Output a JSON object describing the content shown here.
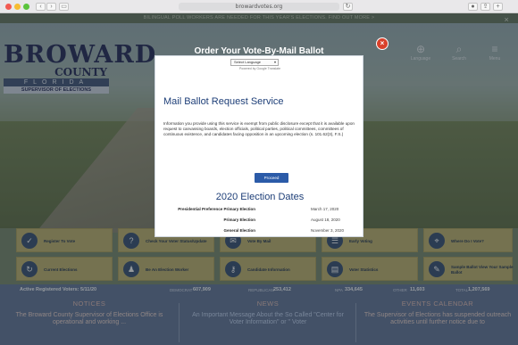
{
  "browser": {
    "url": "browardvotes.org",
    "nav_back": "‹",
    "nav_forward": "›",
    "sidebar_icon": "sidebar-icon",
    "reload": "↻"
  },
  "announcement": {
    "text": "BILINGUAL POLL WORKERS ARE NEEDED FOR THIS YEAR'S ELECTIONS. FIND OUT MORE >",
    "close": "×"
  },
  "logo": {
    "line1": "BROWARD",
    "line2": "COUNTY",
    "line3": "FLORIDA",
    "line4": "SUPERVISOR OF ELECTIONS"
  },
  "topnav": [
    {
      "label": "Language",
      "icon": "globe-icon",
      "glyph": "⊕"
    },
    {
      "label": "Search",
      "icon": "search-icon",
      "glyph": "⌕"
    },
    {
      "label": "Menu",
      "icon": "menu-icon",
      "glyph": "≡"
    }
  ],
  "modal": {
    "title": "Order Your Vote-By-Mail Ballot",
    "close": "×",
    "language_select": "Select Language",
    "powered_by": "Powered by Google Translate",
    "heading": "Mail Ballot Request Service",
    "body": "Information you provide using this service is exempt from public disclosure except that it is available upon request to canvassing boards, election officials, political parties, political committees, committees of continuous existence, and candidates facing opposition in an upcoming election (s. 101.62(3), F.S.)",
    "proceed": "Proceed",
    "dates_heading": "2020 Election Dates",
    "dates": [
      {
        "name": "Presidential Preference Primary Election",
        "date": "March 17, 2020"
      },
      {
        "name": "Primary Election",
        "date": "August 18, 2020"
      },
      {
        "name": "General Election",
        "date": "November 3, 2020"
      }
    ]
  },
  "tiles_row1": [
    {
      "label": "Register To Vote",
      "icon": "check-icon",
      "glyph": "✓"
    },
    {
      "label": "Check Your Voter Status/Update",
      "icon": "question-icon",
      "glyph": "?"
    },
    {
      "label": "Vote By Mail",
      "icon": "mail-icon",
      "glyph": "✉"
    },
    {
      "label": "Early Voting",
      "icon": "list-icon",
      "glyph": "☰"
    },
    {
      "label": "Where Do I Vote?",
      "icon": "location-icon",
      "glyph": "⌖"
    }
  ],
  "tiles_row2": [
    {
      "label": "Current Elections",
      "icon": "refresh-icon",
      "glyph": "↻"
    },
    {
      "label": "Be An Election Worker",
      "icon": "people-icon",
      "glyph": "♟"
    },
    {
      "label": "Candidate Information",
      "icon": "lock-icon",
      "glyph": "⚷"
    },
    {
      "label": "Voter Statistics",
      "icon": "stats-icon",
      "glyph": "▤"
    },
    {
      "label": "Sample Ballot View Your Sample Ballot",
      "icon": "ballot-icon",
      "glyph": "✎"
    }
  ],
  "stats": {
    "active_label": "Active Registered Voters: 5/11/20",
    "democrat_label": "DEMOCRAT",
    "democrat": "607,909",
    "republican_label": "REPUBLICAN",
    "republican": "253,412",
    "npa_label": "NPA",
    "npa": "334,645",
    "other_label": "OTHER",
    "other": "11,603",
    "total_label": "TOTAL",
    "total": "1,207,569"
  },
  "notices": {
    "heading": "NOTICES",
    "text": "The Broward County Supervisor of Elections Office is operational and working ..."
  },
  "news": {
    "heading": "NEWS",
    "text": "An Important Message About the So Called \"Center for Voter Information\" or \" Voter"
  },
  "events": {
    "heading": "EVENTS CALENDAR",
    "text": "The Supervisor of Elections has suspended outreach activities until further notice due to"
  }
}
